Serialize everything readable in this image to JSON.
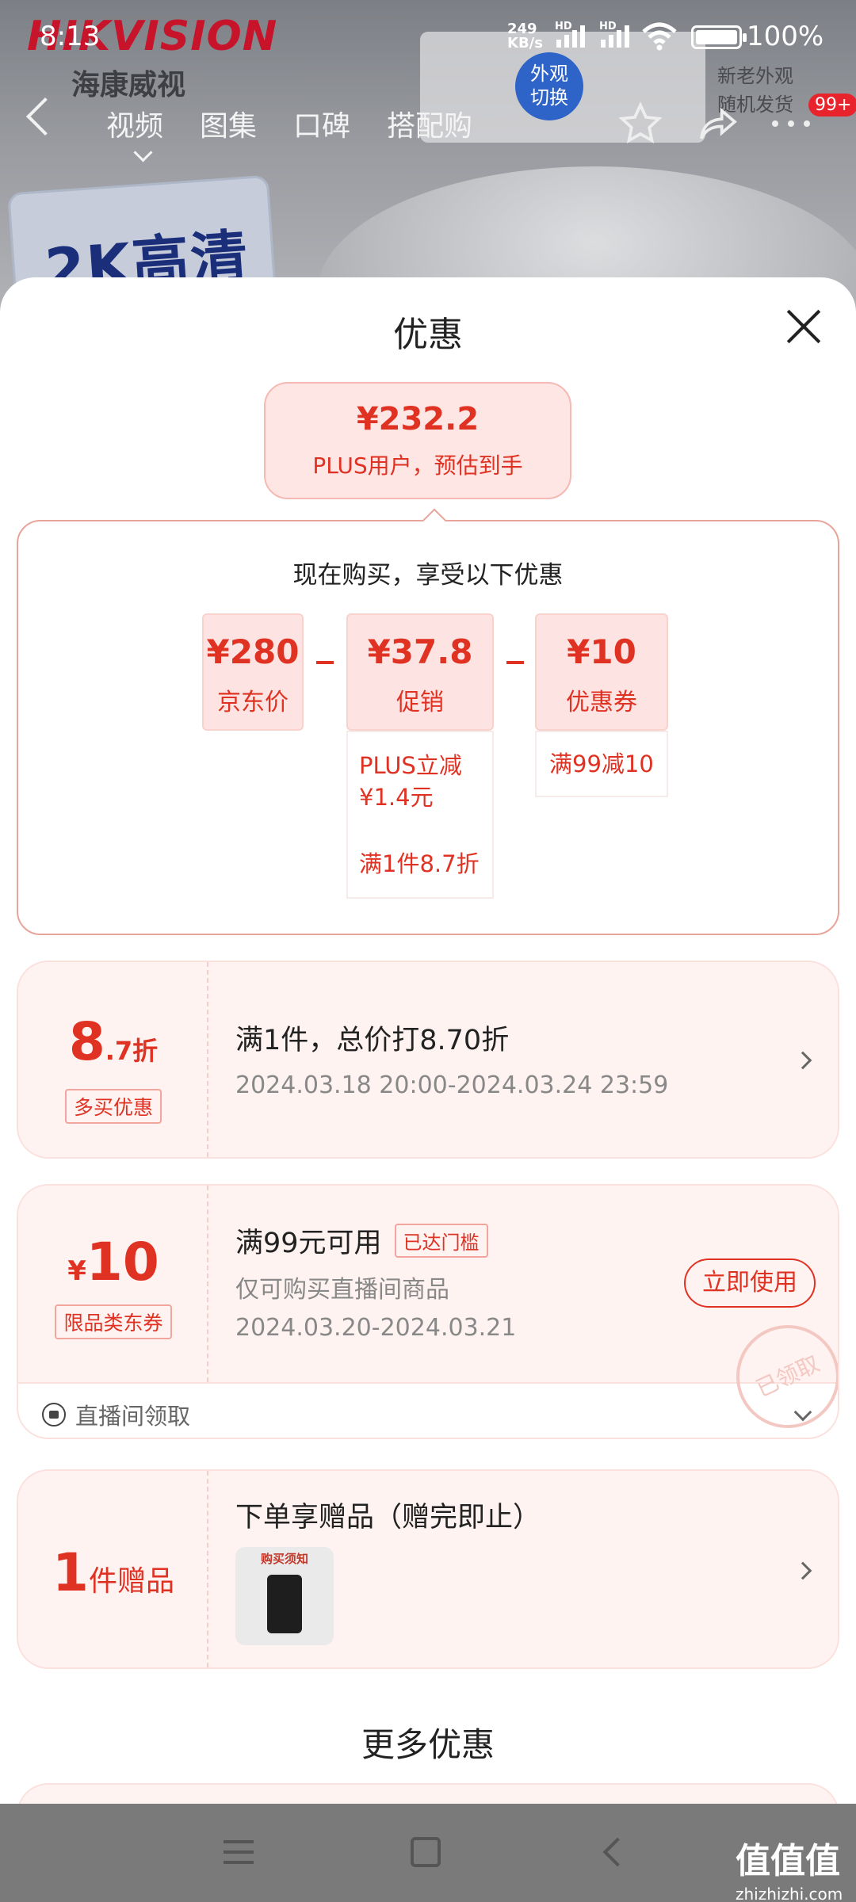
{
  "status_bar": {
    "time": "8:13",
    "net_speed_value": "249",
    "net_speed_unit": "KB/s",
    "hd1": "HD",
    "hd2": "HD",
    "battery": "100%"
  },
  "background": {
    "brand": "HIKVISION",
    "brand_cn": "海康威视",
    "promo_badge": "外观\n切换",
    "promo_text": "新老外观\n随机发货",
    "hero_text": "2K高清"
  },
  "nav": {
    "tabs": [
      "视频",
      "图集",
      "口碑",
      "搭配购"
    ],
    "badge": "99+",
    "icons": [
      "back-icon",
      "star-icon",
      "share-icon",
      "more-icon"
    ]
  },
  "sheet": {
    "title": "优惠",
    "final_price": "¥232.2",
    "final_label": "PLUS用户，预估到手",
    "calc_title": "现在购买，享受以下优惠",
    "boxes": [
      {
        "value": "¥280",
        "label": "京东价"
      },
      {
        "value": "¥37.8",
        "label": "促销"
      },
      {
        "value": "¥10",
        "label": "优惠券"
      }
    ],
    "promo_details": [
      "PLUS立减\n¥1.4元",
      "满1件8.7折"
    ],
    "coupon_detail": "满99减10"
  },
  "cards": {
    "discount": {
      "big": "8",
      "small": ".7折",
      "tag": "多买优惠",
      "title": "满1件，总价打8.70折",
      "date": "2024.03.18 20:00-2024.03.24 23:59"
    },
    "coupon": {
      "currency": "¥",
      "amount": "10",
      "tag": "限品类东券",
      "title": "满99元可用",
      "badge": "已达门槛",
      "desc": "仅可购买直播间商品",
      "date": "2024.03.20-2024.03.21",
      "button": "立即使用",
      "stamp": "已领取",
      "source": "直播间领取"
    },
    "gift": {
      "big": "1",
      "small": "件赠品",
      "title": "下单享赠品（赠完即止）",
      "thumb_text": "购买须知"
    }
  },
  "more_title": "更多优惠",
  "watermark": {
    "cn": "值值值",
    "en": "zhizhizhi.com"
  },
  "colors": {
    "accent": "#e03223",
    "pill_bg": "#fde6e4",
    "card_bg": "#fff3f2"
  }
}
